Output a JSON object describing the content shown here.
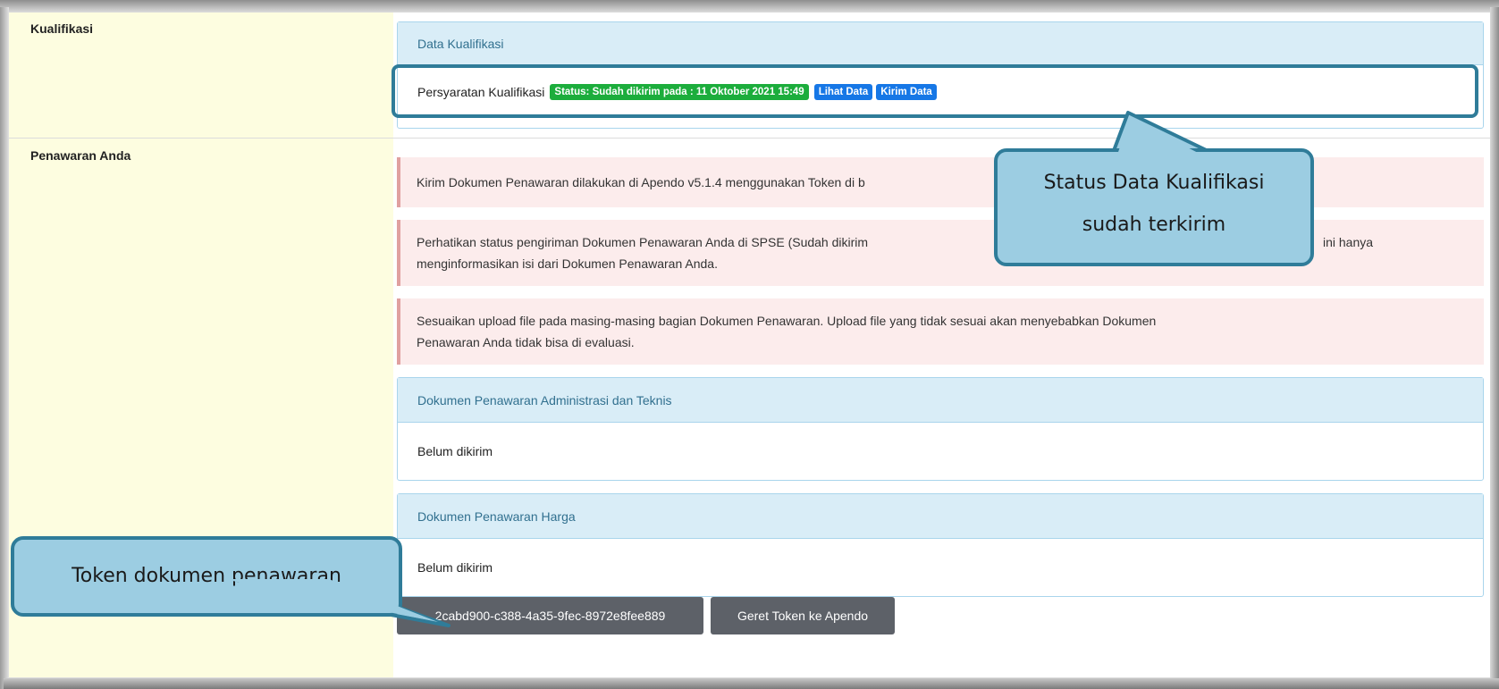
{
  "sections": {
    "kualifikasi_label": "Kualifikasi",
    "penawaran_label": "Penawaran Anda"
  },
  "kualifikasi_panel": {
    "heading": "Data Kualifikasi",
    "item_label": "Persyaratan Kualifikasi",
    "status_badge": "Status: Sudah dikirim pada : 11 Oktober 2021 15:49",
    "view_button": "Lihat Data",
    "send_button": "Kirim Data"
  },
  "alerts": [
    "Kirim Dokumen Penawaran dilakukan di Apendo v5.1.4 menggunakan Token di b",
    "Perhatikan status pengiriman Dokumen Penawaran Anda di SPSE (Sudah dikirim",
    "ini hanya",
    "menginformasikan isi dari Dokumen Penawaran Anda.",
    "Sesuaikan upload file pada masing-masing bagian Dokumen Penawaran. Upload file yang tidak sesuai akan menyebabkan Dokumen",
    "Penawaran Anda tidak bisa di evaluasi."
  ],
  "admin_panel": {
    "heading": "Dokumen Penawaran Administrasi dan Teknis",
    "status": "Belum dikirim"
  },
  "harga_panel": {
    "heading": "Dokumen Penawaran Harga",
    "status": "Belum dikirim"
  },
  "token": {
    "value": "2cabd900-c388-4a35-9fec-8972e8fee889",
    "send_button": "Geret Token ke Apendo"
  },
  "callouts": {
    "status_line1": "Status Data Kualifikasi",
    "status_line2": "sudah terkirim",
    "token": "Token dokumen penawaran"
  },
  "colors": {
    "callout_fill": "#9ccde2",
    "callout_border": "#2f7c99",
    "badge_green": "#1cad3c",
    "badge_blue": "#1677e6"
  }
}
